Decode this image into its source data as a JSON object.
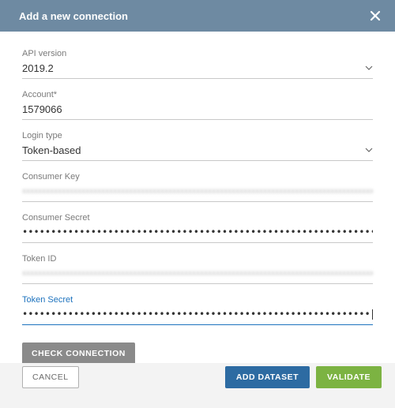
{
  "header": {
    "title": "Add a new connection",
    "close_icon": "close-icon"
  },
  "fields": {
    "api_version": {
      "label": "API version",
      "value": "2019.2"
    },
    "account": {
      "label": "Account*",
      "value": "1579066"
    },
    "login_type": {
      "label": "Login type",
      "value": "Token-based"
    },
    "consumer_key": {
      "label": "Consumer Key",
      "masked_value": "xxxxxxxxxxxxxxxxxxxxxxxxxxxxxxxxxxxxxxxxxxxxxxxxxxxxxxxxxxxxxxxxxxxxxxxxxxxxxxxxxxxxxxxxxxxxxxxxxxxxxxxxxxxxxxxx"
    },
    "consumer_secret": {
      "label": "Consumer Secret",
      "masked_value": "•••••••••••••••••••••••••••••••••••••••••••••••••••••••••••••••"
    },
    "token_id": {
      "label": "Token ID",
      "masked_value": "xxxxxxxxxxxxxxxxxxxxxxxxxxxxxxxxxxxxxxxxxxxxxxxxxxxxxxxxxxxxxxxxxxxxxxxxxxxxxxxxxxxxxxxxxxxxxxxx"
    },
    "token_secret": {
      "label": "Token Secret",
      "masked_value": "••••••••••••••••••••••••••••••••••••••••••••••••••••••••••••••••"
    }
  },
  "actions": {
    "check_connection": "CHECK CONNECTION",
    "cancel": "CANCEL",
    "add_dataset": "ADD DATASET",
    "validate": "VALIDATE"
  }
}
